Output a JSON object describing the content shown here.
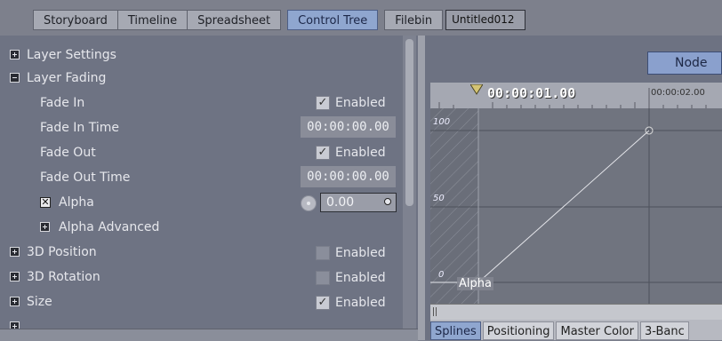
{
  "top_tabs": [
    {
      "label": "Storyboard"
    },
    {
      "label": "Timeline"
    },
    {
      "label": "Spreadsheet"
    },
    {
      "label": "Control Tree"
    },
    {
      "label": "Filebin"
    }
  ],
  "document_name": "Untitled012",
  "tree": {
    "layer_settings": "Layer Settings",
    "layer_fading": "Layer Fading",
    "fade_in": {
      "label": "Fade In",
      "state": "Enabled"
    },
    "fade_in_time": {
      "label": "Fade In Time",
      "value": "00:00:00.00"
    },
    "fade_out": {
      "label": "Fade Out",
      "state": "Enabled"
    },
    "fade_out_time": {
      "label": "Fade Out Time",
      "value": "00:00:00.00"
    },
    "alpha": {
      "label": "Alpha",
      "value": "0.00"
    },
    "alpha_advanced": "Alpha Advanced",
    "position_3d": {
      "label": "3D Position",
      "state": "Enabled"
    },
    "rotation_3d": {
      "label": "3D Rotation",
      "state": "Enabled"
    },
    "size": {
      "label": "Size",
      "state": "Enabled"
    }
  },
  "node_button": "Node",
  "ruler": {
    "current_time": "00:00:01.00",
    "next_tick": "00:00:02.00"
  },
  "graph": {
    "y_labels": [
      "100",
      "50",
      "0"
    ],
    "curve_label": "Alpha",
    "keyframes_percent": [
      0,
      100
    ]
  },
  "bottom_tabs": [
    {
      "label": "Splines"
    },
    {
      "label": "Positioning"
    },
    {
      "label": "Master Color"
    },
    {
      "label": "3-Banc"
    }
  ],
  "colors": {
    "accent": "#8fa6cf",
    "panel": "#6e7383"
  }
}
